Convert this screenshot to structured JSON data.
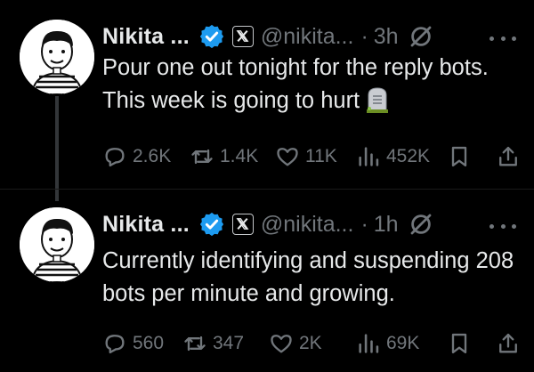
{
  "tweets": [
    {
      "name": "Nikita ...",
      "handle": "@nikita...",
      "separator": "·",
      "time": "3h",
      "text": "Pour one out tonight for the reply bots. This week is going to hurt",
      "emoji": "headstone-icon",
      "replies": "2.6K",
      "reposts": "1.4K",
      "likes": "11K",
      "views": "452K"
    },
    {
      "name": "Nikita ...",
      "handle": "@nikita...",
      "separator": "·",
      "time": "1h",
      "text": "Currently identifying and suspending 208 bots per minute and growing.",
      "replies": "560",
      "reposts": "347",
      "likes": "2K",
      "views": "69K"
    }
  ],
  "colors": {
    "background": "#000000",
    "text": "#e7e9ea",
    "muted": "#71767b",
    "verified": "#1d9bf0"
  }
}
